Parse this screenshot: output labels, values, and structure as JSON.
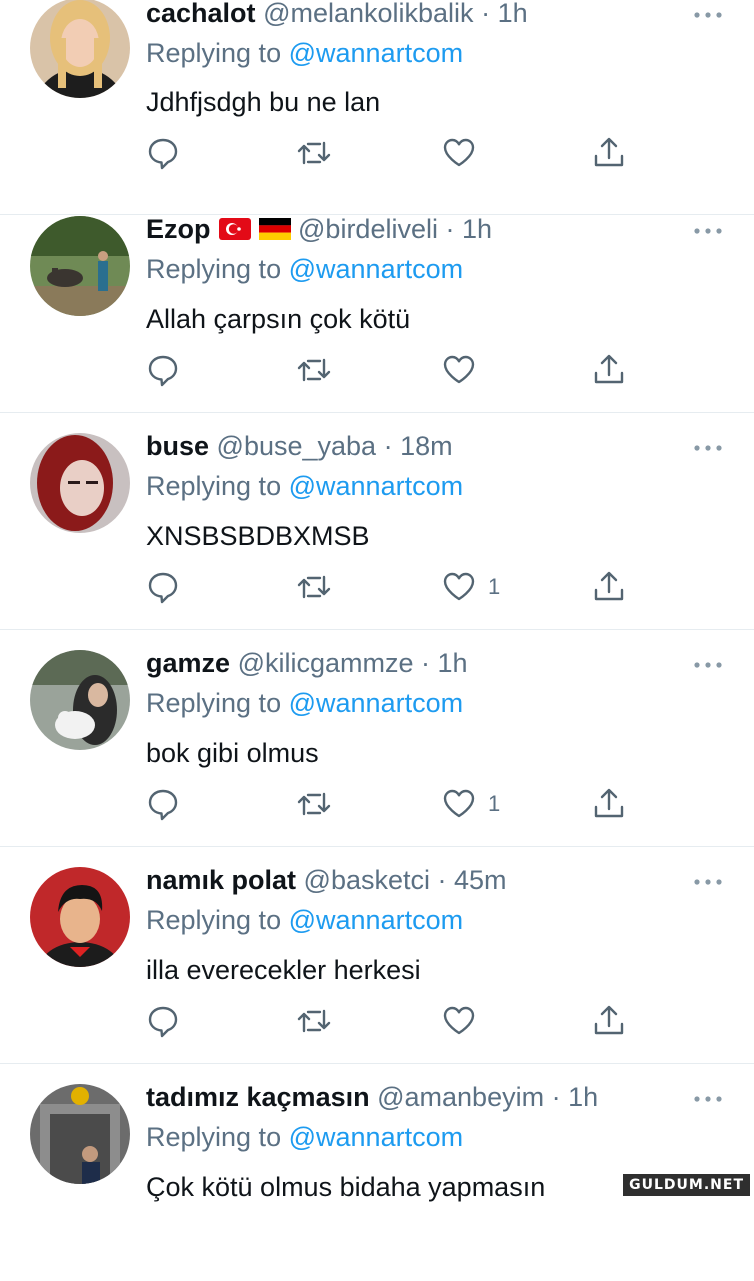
{
  "tweets": [
    {
      "name": "cachalot",
      "handle": "@melankolikbalik",
      "time": "1h",
      "replying_prefix": "Replying to",
      "replying_to": "@wannartcom",
      "text": "Jdhfjsdgh bu ne lan",
      "likes": ""
    },
    {
      "name": "Ezop",
      "handle": "@birdeliveli",
      "time": "1h",
      "replying_prefix": "Replying to",
      "replying_to": "@wannartcom",
      "text": "Allah çarpsın çok kötü",
      "likes": "",
      "flags": [
        "turkey-flag",
        "germany-flag"
      ]
    },
    {
      "name": "buse",
      "handle": "@buse_yaba",
      "time": "18m",
      "replying_prefix": "Replying to",
      "replying_to": "@wannartcom",
      "text": "XNSBSBDBXMSB",
      "likes": "1"
    },
    {
      "name": "gamze",
      "handle": "@kilicgammze",
      "time": "1h",
      "replying_prefix": "Replying to",
      "replying_to": "@wannartcom",
      "text": "bok gibi olmus",
      "likes": "1"
    },
    {
      "name": "namık polat",
      "handle": "@basketci",
      "time": "45m",
      "replying_prefix": "Replying to",
      "replying_to": "@wannartcom",
      "text": "illa everecekler herkesi",
      "likes": ""
    },
    {
      "name": "tadımız kaçmasın",
      "handle": "@amanbeyim",
      "time": "1h",
      "replying_prefix": "Replying to",
      "replying_to": "@wannartcom",
      "text": "Çok kötü olmus bidaha yapmasın",
      "likes": ""
    }
  ],
  "separator": " · ",
  "watermark": "GULDUM.NET",
  "colors": {
    "accent": "#1d9bf0",
    "muted": "#5b7083",
    "text": "#0f1419",
    "divider": "#e6ecf0"
  }
}
